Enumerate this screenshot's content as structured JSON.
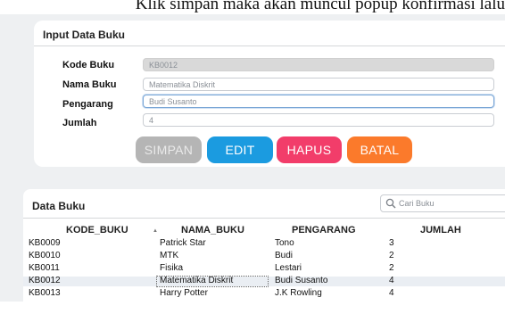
{
  "caption": "Klik simpan maka akan muncul popup konfirmasi lalu",
  "form": {
    "title": "Input Data Buku",
    "fields": [
      {
        "label": "Kode Buku",
        "value": "KB0012"
      },
      {
        "label": "Nama Buku",
        "value": "Matematika Diskrit"
      },
      {
        "label": "Pengarang",
        "value": "Budi Susanto"
      },
      {
        "label": "Jumlah",
        "value": "4"
      }
    ],
    "buttons": {
      "simpan": "SIMPAN",
      "edit": "EDIT",
      "hapus": "HAPUS",
      "batal": "BATAL"
    }
  },
  "table": {
    "title": "Data Buku",
    "search_placeholder": "Cari Buku",
    "columns": [
      "KODE_BUKU",
      "NAMA_BUKU",
      "PENGARANG",
      "JUMLAH"
    ],
    "rows": [
      [
        "KB0009",
        "Patrick Star",
        "Tono",
        "3"
      ],
      [
        "KB0010",
        "MTK",
        "Budi",
        "2"
      ],
      [
        "KB0011",
        "Fisika",
        "Lestari",
        "2"
      ],
      [
        "KB0012",
        "Matematika Diskrit",
        "Budi Susanto",
        "4"
      ],
      [
        "KB0013",
        "Harry Potter",
        "J.K Rowling",
        "4"
      ]
    ]
  },
  "colors": {
    "simpan": "#b5b5b5",
    "edit": "#1b9be0",
    "hapus": "#f23d6a",
    "batal": "#fb7a2b"
  },
  "icons": {
    "search": "search-icon",
    "sort": "sort-asc-icon"
  }
}
